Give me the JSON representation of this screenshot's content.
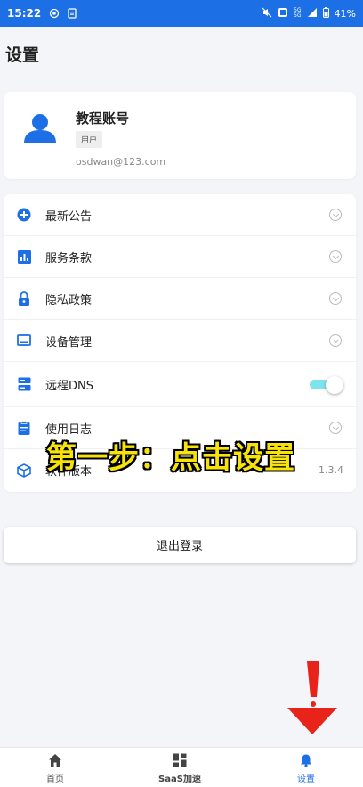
{
  "status_bar": {
    "time": "15:22",
    "battery": "41%",
    "signal_top": "5G",
    "signal_bottom": "5G"
  },
  "page": {
    "title": "设置"
  },
  "profile": {
    "name": "教程账号",
    "role": "用户",
    "email": "osdwan@123.com"
  },
  "menu": {
    "items": [
      {
        "label": "最新公告",
        "icon": "plus-circle-icon"
      },
      {
        "label": "服务条款",
        "icon": "bar-chart-icon"
      },
      {
        "label": "隐私政策",
        "icon": "lock-icon"
      },
      {
        "label": "设备管理",
        "icon": "monitor-icon"
      },
      {
        "label": "远程DNS",
        "icon": "server-icon",
        "toggle_on": true
      },
      {
        "label": "使用日志",
        "icon": "clipboard-icon"
      },
      {
        "label": "软件版本",
        "icon": "cube-icon",
        "value": "1.3.4"
      }
    ]
  },
  "logout": {
    "label": "退出登录"
  },
  "overlay": {
    "text": "第一步：点击设置"
  },
  "bottom_nav": {
    "home": "首页",
    "saas": "SaaS加速",
    "settings": "设置"
  },
  "colors": {
    "accent": "#1d6fe6",
    "toggle_track": "#7fe3ec",
    "overlay_text": "#f7e30a",
    "arrow": "#e8231a"
  }
}
